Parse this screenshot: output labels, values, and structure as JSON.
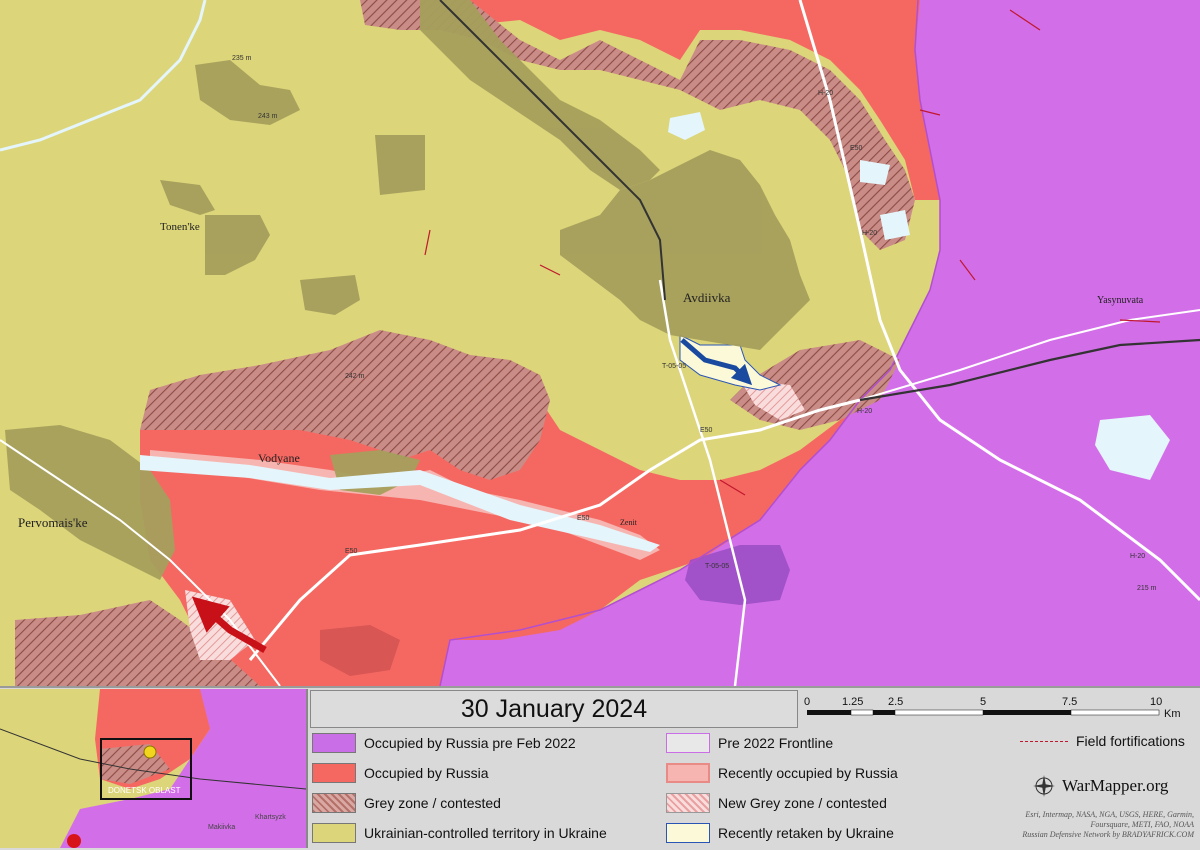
{
  "map": {
    "places": {
      "avdiivka": "Avdiivka",
      "tonenke": "Tonen'ke",
      "vodyane": "Vodyane",
      "pervomaiske": "Pervomais'ke",
      "yasynuvata": "Yasynuvata",
      "zenit": "Zenit"
    },
    "road_labels": {
      "h20_a": "H-20",
      "h20_b": "H-20",
      "h20_c": "H-20",
      "h20_d": "H-20",
      "e50_a": "E50",
      "e50_b": "E50",
      "e50_c": "E50",
      "e50_d": "E50",
      "t0505_a": "T-05-05",
      "t0505_b": "T-05-05"
    },
    "elevations": {
      "e1": "235 m",
      "e2": "243 m",
      "e3": "242 m",
      "e4": "215 m"
    },
    "colors": {
      "ukraine": "#dcd57a",
      "russia": "#f56862",
      "pre2022": "#d36ee9",
      "grey_zone": "#c98c86",
      "recent_russia": "#f7b5b1",
      "retaken": "#fcf9d9",
      "settlement": "#a59f5c",
      "arrow_red": "#c81018",
      "arrow_blue": "#1a4aa0",
      "fortification": "#c0182c"
    },
    "arrows": [
      {
        "side": "Russia",
        "color": "red"
      },
      {
        "side": "Ukraine",
        "color": "blue"
      }
    ]
  },
  "inset": {
    "labels": {
      "oblast": "DONETSK OBLAST",
      "makiivka": "Makiivka",
      "khartsyzk": "Khartsyzk"
    },
    "frame": "viewport box"
  },
  "legend": {
    "date": "30 January 2024",
    "items": [
      {
        "label": "Occupied by Russia pre Feb 2022",
        "style": "solid",
        "color": "#c96ee6"
      },
      {
        "label": "Occupied by Russia",
        "style": "solid",
        "color": "#f56862"
      },
      {
        "label": "Grey zone / contested",
        "style": "hatch",
        "color": "#b5706a"
      },
      {
        "label": "Ukrainian-controlled territory in Ukraine",
        "style": "solid",
        "color": "#dcd57a"
      },
      {
        "label": "Pre 2022 Frontline",
        "style": "outline",
        "color": "#c96ee6"
      },
      {
        "label": "Recently occupied by Russia",
        "style": "solid",
        "color": "#f7b5b1"
      },
      {
        "label": "New Grey zone / contested",
        "style": "hatch-light",
        "color": "#e8a0a0"
      },
      {
        "label": "Recently retaken by Ukraine",
        "style": "outline-blue",
        "color": "#fcf9d9"
      }
    ],
    "field_fortifications": "Field fortifications",
    "scale": {
      "ticks": [
        "0",
        "1.25",
        "2.5",
        "5",
        "7.5",
        "10"
      ],
      "unit": "Km"
    },
    "brand": "WarMapper.org",
    "credits": [
      "Esri, Intermap, NASA, NGA, USGS, HERE, Garmin,",
      "Foursquare, METI, FAO, NOAA",
      "Russian Defensive Network by BRADYAFRICK.COM"
    ]
  }
}
